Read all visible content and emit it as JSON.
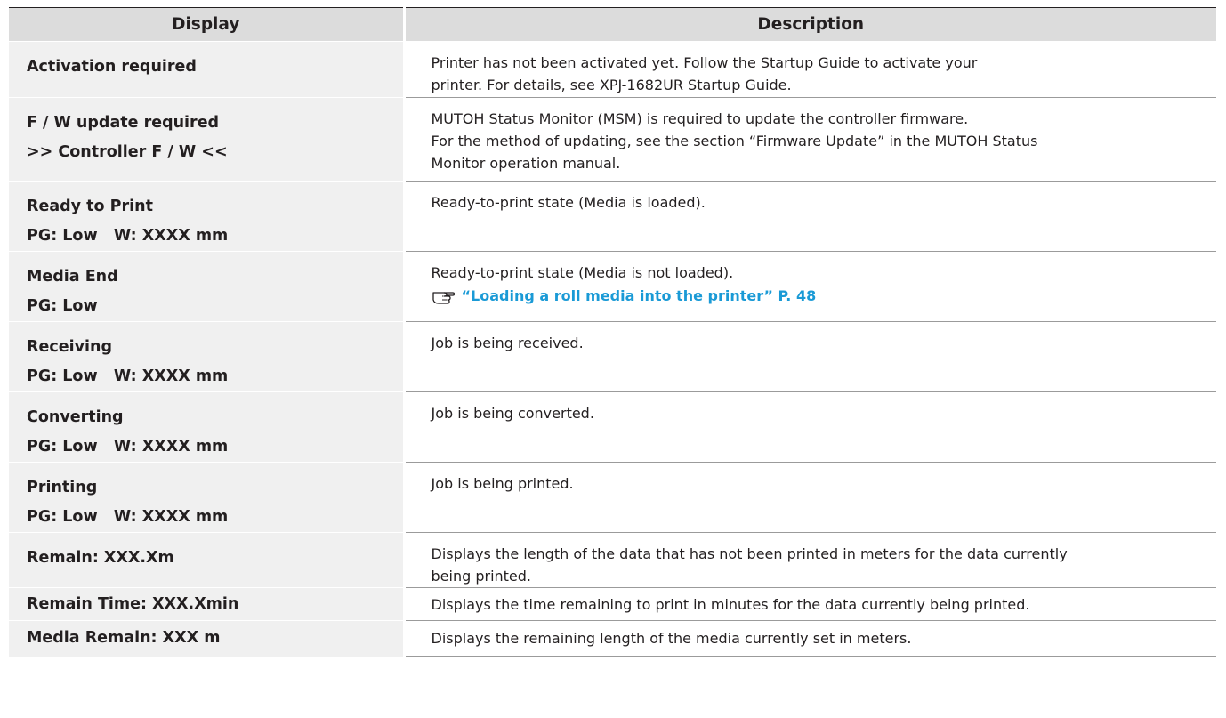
{
  "table": {
    "headers": {
      "display": "Display",
      "description": "Description"
    },
    "rows": [
      {
        "display": [
          "Activation required"
        ],
        "description": [
          "Printer has not been activated yet. Follow the Startup Guide to activate your",
          "printer. For details, see XPJ-1682UR Startup Guide."
        ]
      },
      {
        "display": [
          "F / W update required",
          ">> Controller F / W <<"
        ],
        "description": [
          "MUTOH Status Monitor (MSM) is required to update the controller firmware.",
          "For the method of updating, see the section “Firmware Update” in the MUTOH Status",
          "Monitor operation manual."
        ]
      },
      {
        "display": [
          "Ready to Print",
          "PG: Low   W: XXXX mm"
        ],
        "description": [
          "Ready-to-print state (Media is loaded)."
        ]
      },
      {
        "display": [
          "Media End",
          "PG: Low"
        ],
        "description": [
          "Ready-to-print state (Media is not loaded)."
        ],
        "link": {
          "text": "“Loading a roll media into the printer” P. 48",
          "icon": "pointing-hand-icon",
          "color": "#1a9ad6"
        }
      },
      {
        "display": [
          "Receiving",
          "PG: Low   W: XXXX mm"
        ],
        "description": [
          "Job is being received."
        ]
      },
      {
        "display": [
          "Converting",
          "PG: Low   W: XXXX mm"
        ],
        "description": [
          "Job is being converted."
        ]
      },
      {
        "display": [
          "Printing",
          "PG: Low   W: XXXX mm"
        ],
        "description": [
          "Job is being printed."
        ]
      },
      {
        "display": [
          "Remain: XXX.Xm"
        ],
        "description": [
          "Displays the length of the data that has not been printed in meters for the data currently",
          "being printed."
        ]
      },
      {
        "display": [
          "Remain Time: XXX.Xmin"
        ],
        "description": [
          "Displays the time remaining to print in minutes for the data currently being printed."
        ]
      },
      {
        "display": [
          "Media Remain: XXX m"
        ],
        "description": [
          "Displays the remaining length of the media currently set in meters."
        ]
      }
    ]
  },
  "colors": {
    "header_bg": "#dcdcdc",
    "display_col_bg": "#f0f0f0",
    "link": "#1a9ad6",
    "text": "#231f20"
  }
}
